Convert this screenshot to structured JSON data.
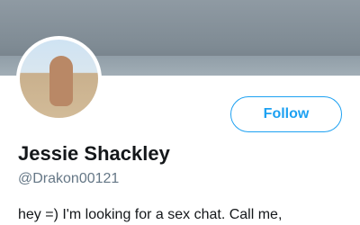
{
  "profile": {
    "display_name": "Jessie Shackley",
    "handle": "@Drakon00121",
    "bio": "hey =) I'm looking for a sex chat. Call me,",
    "follow_label": "Follow"
  },
  "colors": {
    "accent": "#1da1f2",
    "text_primary": "#14171a",
    "text_secondary": "#657786",
    "background": "#ffffff"
  }
}
